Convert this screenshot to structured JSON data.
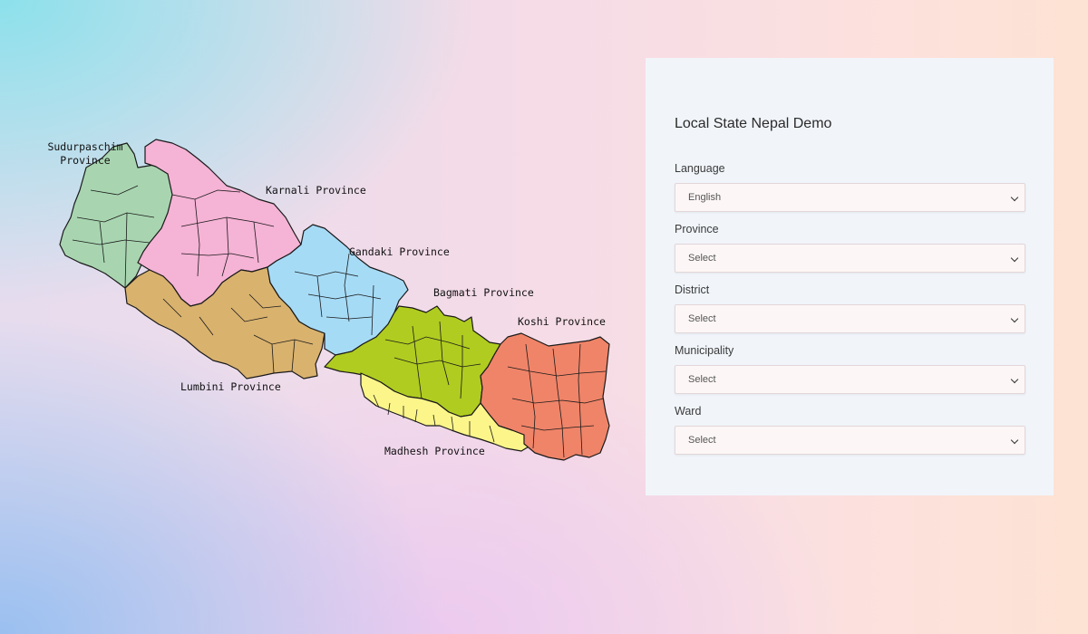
{
  "map": {
    "provinces": [
      {
        "id": "sudurpaschim",
        "label": "Sudurpaschim\nProvince",
        "color": "#a8d5b0"
      },
      {
        "id": "karnali",
        "label": "Karnali Province",
        "color": "#f5b3d5"
      },
      {
        "id": "gandaki",
        "label": "Gandaki Province",
        "color": "#a6dbf6"
      },
      {
        "id": "lumbini",
        "label": "Lumbini Province",
        "color": "#d9b26e"
      },
      {
        "id": "bagmati",
        "label": "Bagmati Province",
        "color": "#b0cc20"
      },
      {
        "id": "madhesh",
        "label": "Madhesh Province",
        "color": "#fcf58a"
      },
      {
        "id": "koshi",
        "label": "Koshi Province",
        "color": "#f08468"
      }
    ]
  },
  "form": {
    "title": "Local State Nepal Demo",
    "fields": [
      {
        "label": "Language",
        "value": "English"
      },
      {
        "label": "Province",
        "value": "Select"
      },
      {
        "label": "District",
        "value": "Select"
      },
      {
        "label": "Municipality",
        "value": "Select"
      },
      {
        "label": "Ward",
        "value": "Select"
      }
    ]
  }
}
